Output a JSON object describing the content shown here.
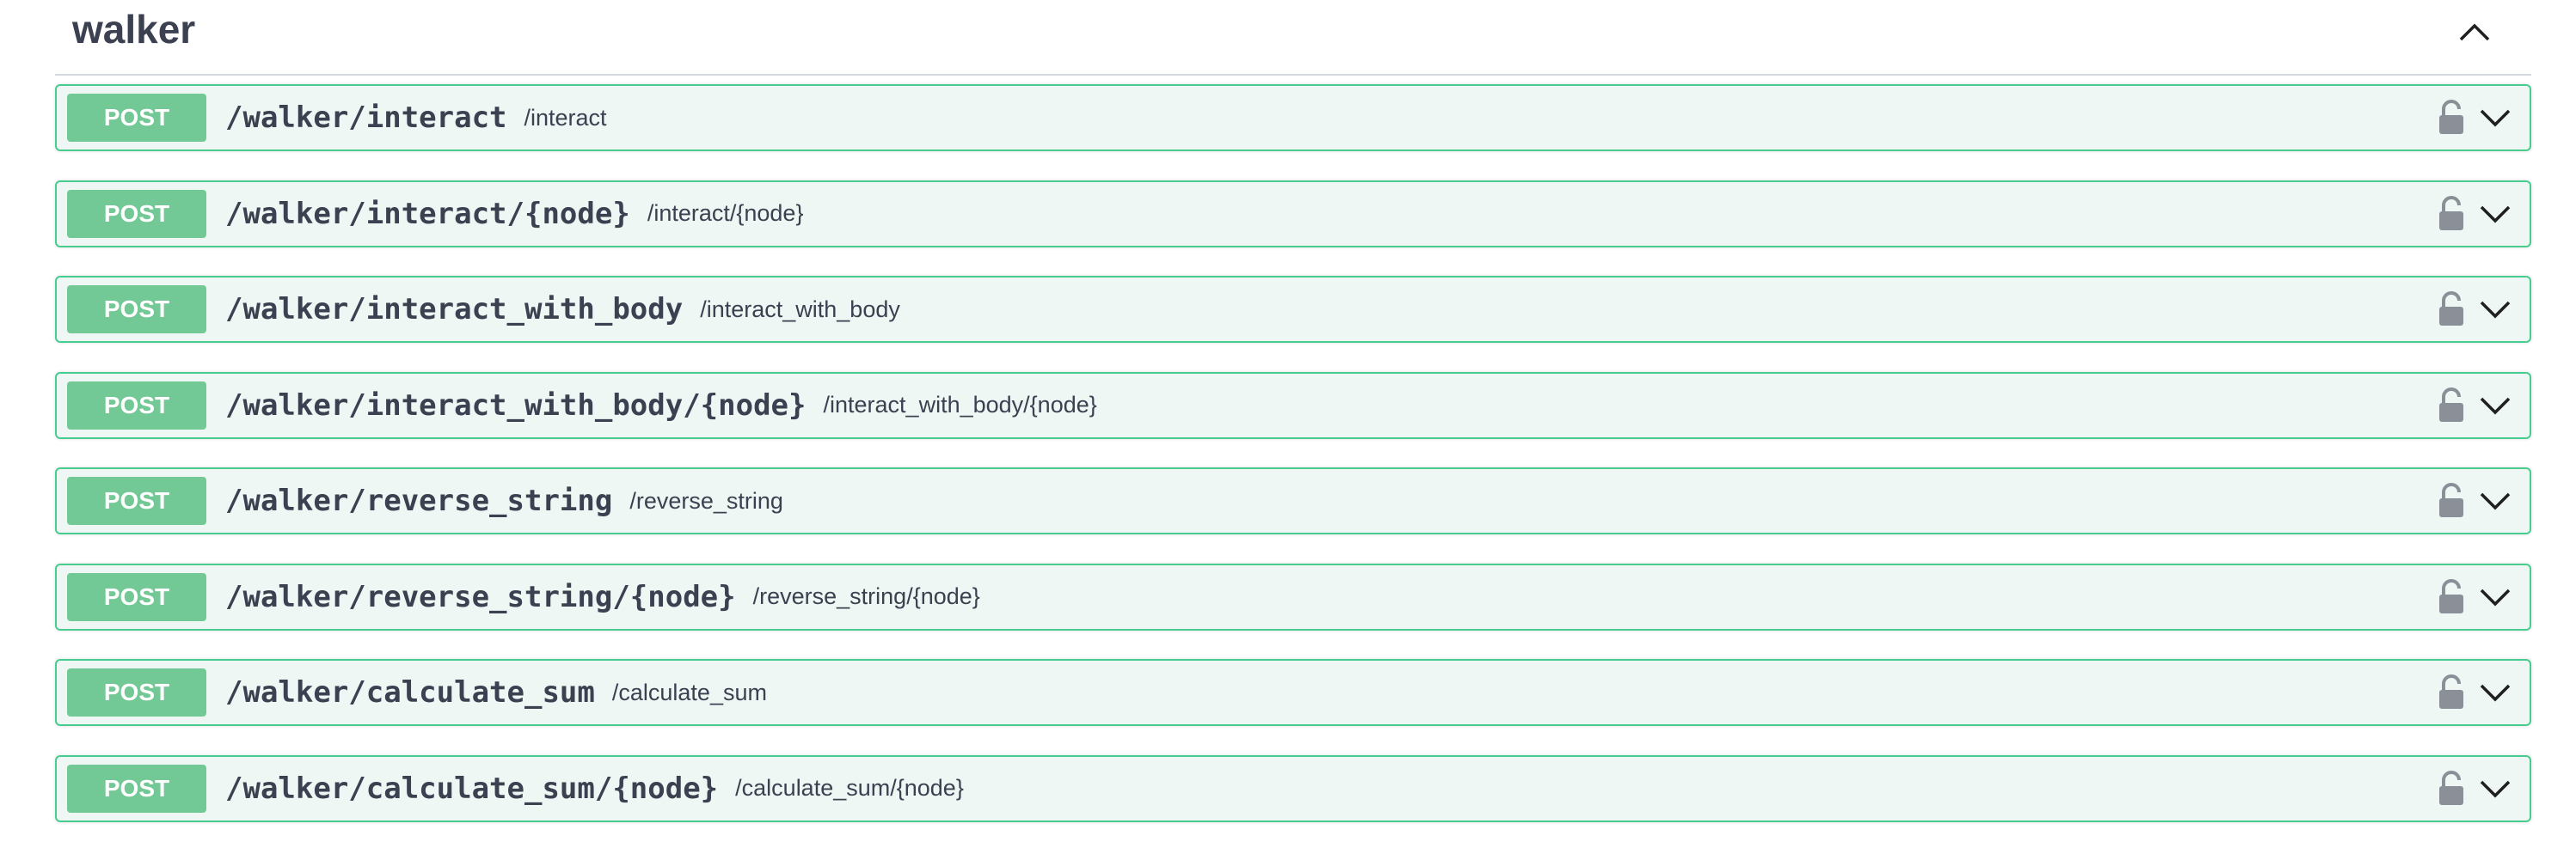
{
  "section": {
    "title": "walker",
    "collapse_icon": "chevron-up-icon"
  },
  "operations": [
    {
      "method": "POST",
      "path": "/walker/interact",
      "summary": "/interact"
    },
    {
      "method": "POST",
      "path": "/walker/interact/{node}",
      "summary": "/interact/{node}"
    },
    {
      "method": "POST",
      "path": "/walker/interact_with_body",
      "summary": "/interact_with_body"
    },
    {
      "method": "POST",
      "path": "/walker/interact_with_body/{node}",
      "summary": "/interact_with_body/{node}"
    },
    {
      "method": "POST",
      "path": "/walker/reverse_string",
      "summary": "/reverse_string"
    },
    {
      "method": "POST",
      "path": "/walker/reverse_string/{node}",
      "summary": "/reverse_string/{node}"
    },
    {
      "method": "POST",
      "path": "/walker/calculate_sum",
      "summary": "/calculate_sum"
    },
    {
      "method": "POST",
      "path": "/walker/calculate_sum/{node}",
      "summary": "/calculate_sum/{node}"
    }
  ],
  "colors": {
    "post_accent": "#49cc90",
    "post_badge": "#73c995",
    "row_background": "#eef7f3",
    "text": "#3b4151"
  },
  "icons": {
    "lock": "lock-open-icon",
    "expand": "chevron-down-icon"
  }
}
